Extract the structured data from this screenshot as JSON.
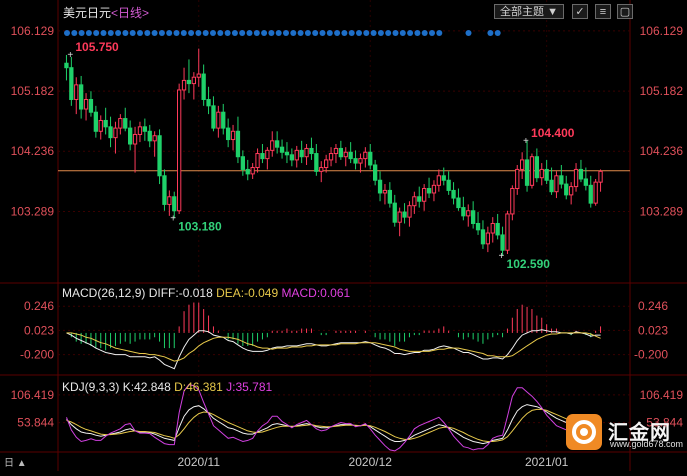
{
  "header": {
    "instrument": "美元日元",
    "period": "<日线>",
    "theme_label": "全部主题",
    "buttons": [
      "✓",
      "≡",
      "▢"
    ]
  },
  "chart_data": [
    {
      "type": "candlestick",
      "name": "price",
      "y_ticks": [
        106.129,
        105.182,
        104.236,
        103.289
      ],
      "ylim": [
        102.4,
        106.3
      ],
      "last_price": 103.93,
      "annotations": [
        {
          "label": "105.750",
          "value": 105.75,
          "index": 1,
          "color": "#ff3a5a"
        },
        {
          "label": "103.180",
          "value": 103.18,
          "index": 22,
          "color": "#33d17a"
        },
        {
          "label": "104.400",
          "value": 104.4,
          "index": 94,
          "color": "#ff3a5a"
        },
        {
          "label": "102.590",
          "value": 102.59,
          "index": 89,
          "color": "#33d17a"
        }
      ],
      "candles": [
        [
          105.62,
          105.75,
          105.35,
          105.55
        ],
        [
          105.55,
          105.72,
          104.95,
          105.05
        ],
        [
          105.05,
          105.4,
          104.82,
          105.28
        ],
        [
          105.28,
          105.42,
          104.75,
          104.9
        ],
        [
          104.9,
          105.15,
          104.72,
          105.05
        ],
        [
          105.05,
          105.18,
          104.78,
          104.85
        ],
        [
          104.85,
          104.95,
          104.45,
          104.55
        ],
        [
          104.55,
          104.8,
          104.42,
          104.72
        ],
        [
          104.72,
          104.92,
          104.5,
          104.62
        ],
        [
          104.62,
          104.78,
          104.3,
          104.45
        ],
        [
          104.45,
          104.7,
          104.2,
          104.6
        ],
        [
          104.6,
          104.82,
          104.5,
          104.75
        ],
        [
          104.75,
          104.92,
          104.55,
          104.6
        ],
        [
          104.6,
          104.72,
          104.25,
          104.35
        ],
        [
          104.35,
          104.62,
          103.9,
          104.5
        ],
        [
          104.5,
          104.7,
          104.38,
          104.62
        ],
        [
          104.62,
          104.75,
          104.4,
          104.55
        ],
        [
          104.55,
          104.65,
          104.3,
          104.4
        ],
        [
          104.4,
          104.55,
          104.15,
          104.48
        ],
        [
          104.48,
          104.58,
          103.72,
          103.85
        ],
        [
          103.85,
          103.95,
          103.3,
          103.4
        ],
        [
          103.4,
          103.62,
          103.22,
          103.52
        ],
        [
          103.52,
          103.6,
          103.18,
          103.3
        ],
        [
          103.3,
          105.3,
          103.25,
          105.2
        ],
        [
          105.2,
          105.55,
          105.05,
          105.35
        ],
        [
          105.35,
          105.68,
          105.15,
          105.3
        ],
        [
          105.3,
          105.48,
          105.05,
          105.4
        ],
        [
          105.4,
          105.85,
          105.25,
          105.45
        ],
        [
          105.45,
          105.6,
          104.95,
          105.05
        ],
        [
          105.05,
          105.25,
          104.82,
          104.95
        ],
        [
          104.95,
          105.1,
          104.55,
          104.6
        ],
        [
          104.6,
          104.95,
          104.45,
          104.85
        ],
        [
          104.85,
          104.98,
          104.5,
          104.6
        ],
        [
          104.6,
          104.75,
          104.3,
          104.42
        ],
        [
          104.42,
          104.65,
          104.25,
          104.55
        ],
        [
          104.55,
          104.78,
          104.05,
          104.15
        ],
        [
          104.15,
          104.25,
          103.85,
          103.95
        ],
        [
          103.95,
          104.1,
          103.78,
          103.88
        ],
        [
          103.88,
          104.05,
          103.8,
          103.98
        ],
        [
          103.98,
          104.28,
          103.9,
          104.2
        ],
        [
          104.2,
          104.35,
          104.05,
          104.12
        ],
        [
          104.12,
          104.3,
          103.95,
          104.25
        ],
        [
          104.25,
          104.55,
          104.15,
          104.4
        ],
        [
          104.4,
          104.55,
          104.2,
          104.3
        ],
        [
          104.3,
          104.42,
          104.12,
          104.22
        ],
        [
          104.22,
          104.38,
          104.05,
          104.18
        ],
        [
          104.18,
          104.28,
          104.0,
          104.1
        ],
        [
          104.1,
          104.32,
          103.98,
          104.25
        ],
        [
          104.25,
          104.4,
          104.05,
          104.15
        ],
        [
          104.15,
          104.35,
          104.02,
          104.28
        ],
        [
          104.28,
          104.45,
          104.1,
          104.2
        ],
        [
          104.2,
          104.35,
          103.85,
          103.92
        ],
        [
          103.92,
          104.08,
          103.75,
          103.98
        ],
        [
          103.98,
          104.18,
          103.9,
          104.1
        ],
        [
          104.1,
          104.3,
          104.0,
          104.2
        ],
        [
          104.2,
          104.35,
          104.05,
          104.28
        ],
        [
          104.28,
          104.4,
          104.1,
          104.15
        ],
        [
          104.15,
          104.3,
          104.0,
          104.22
        ],
        [
          104.22,
          104.38,
          104.05,
          104.12
        ],
        [
          104.12,
          104.25,
          103.95,
          104.05
        ],
        [
          104.05,
          104.2,
          103.9,
          104.12
        ],
        [
          104.12,
          104.3,
          103.98,
          104.22
        ],
        [
          104.22,
          104.35,
          103.95,
          104.02
        ],
        [
          104.02,
          104.1,
          103.7,
          103.78
        ],
        [
          103.78,
          103.92,
          103.45,
          103.58
        ],
        [
          103.58,
          103.72,
          103.4,
          103.62
        ],
        [
          103.62,
          103.75,
          103.35,
          103.42
        ],
        [
          103.42,
          103.55,
          103.05,
          103.12
        ],
        [
          103.12,
          103.35,
          102.9,
          103.28
        ],
        [
          103.28,
          103.42,
          103.1,
          103.2
        ],
        [
          103.2,
          103.45,
          103.05,
          103.38
        ],
        [
          103.38,
          103.6,
          103.25,
          103.52
        ],
        [
          103.52,
          103.68,
          103.35,
          103.45
        ],
        [
          103.45,
          103.72,
          103.3,
          103.65
        ],
        [
          103.65,
          103.82,
          103.5,
          103.58
        ],
        [
          103.58,
          103.78,
          103.45,
          103.7
        ],
        [
          103.7,
          103.95,
          103.6,
          103.85
        ],
        [
          103.85,
          103.98,
          103.7,
          103.78
        ],
        [
          103.78,
          103.92,
          103.55,
          103.62
        ],
        [
          103.62,
          103.75,
          103.4,
          103.5
        ],
        [
          103.5,
          103.65,
          103.3,
          103.35
        ],
        [
          103.35,
          103.52,
          103.15,
          103.22
        ],
        [
          103.22,
          103.4,
          103.05,
          103.3
        ],
        [
          103.3,
          103.45,
          103.02,
          103.1
        ],
        [
          103.1,
          103.28,
          102.92,
          103.0
        ],
        [
          103.0,
          103.15,
          102.7,
          102.78
        ],
        [
          102.78,
          103.05,
          102.65,
          102.95
        ],
        [
          102.95,
          103.2,
          102.8,
          103.1
        ],
        [
          103.1,
          103.25,
          102.85,
          102.92
        ],
        [
          102.92,
          103.05,
          102.59,
          102.68
        ],
        [
          102.68,
          103.3,
          102.62,
          103.25
        ],
        [
          103.25,
          103.7,
          103.15,
          103.65
        ],
        [
          103.65,
          104.02,
          103.55,
          103.95
        ],
        [
          103.95,
          104.22,
          103.8,
          104.1
        ],
        [
          104.1,
          104.4,
          103.6,
          103.7
        ],
        [
          103.7,
          104.2,
          103.65,
          104.15
        ],
        [
          104.15,
          104.28,
          103.75,
          103.82
        ],
        [
          103.82,
          104.05,
          103.7,
          103.95
        ],
        [
          103.95,
          104.1,
          103.72,
          103.78
        ],
        [
          103.78,
          103.98,
          103.55,
          103.6
        ],
        [
          103.6,
          103.92,
          103.5,
          103.85
        ],
        [
          103.85,
          104.02,
          103.65,
          103.72
        ],
        [
          103.72,
          103.85,
          103.48,
          103.55
        ],
        [
          103.55,
          103.75,
          103.4,
          103.68
        ],
        [
          103.68,
          104.05,
          103.6,
          103.95
        ],
        [
          103.95,
          104.1,
          103.75,
          103.8
        ],
        [
          103.8,
          103.98,
          103.62,
          103.7
        ],
        [
          103.7,
          103.85,
          103.35,
          103.42
        ],
        [
          103.42,
          103.8,
          103.38,
          103.75
        ],
        [
          103.75,
          103.95,
          103.6,
          103.92
        ]
      ],
      "dots": {
        "count": 60,
        "color": "#1e6fc8"
      }
    },
    {
      "type": "macd",
      "name": "MACD",
      "label": "MACD(26,12,9)",
      "diff_label": "DIFF:-0.018",
      "dea_label": "DEA:-0.049",
      "macd_label": "MACD:0.061",
      "y_ticks": [
        0.246,
        0.023,
        -0.2
      ],
      "ylim": [
        -0.36,
        0.34
      ],
      "diff": [
        0.0,
        -0.02,
        -0.05,
        -0.07,
        -0.09,
        -0.11,
        -0.14,
        -0.16,
        -0.18,
        -0.19,
        -0.2,
        -0.2,
        -0.2,
        -0.22,
        -0.22,
        -0.22,
        -0.22,
        -0.23,
        -0.22,
        -0.25,
        -0.29,
        -0.31,
        -0.33,
        -0.22,
        -0.13,
        -0.06,
        -0.02,
        0.02,
        0.02,
        0.01,
        -0.02,
        -0.03,
        -0.04,
        -0.07,
        -0.08,
        -0.11,
        -0.14,
        -0.16,
        -0.17,
        -0.17,
        -0.17,
        -0.16,
        -0.14,
        -0.13,
        -0.13,
        -0.12,
        -0.12,
        -0.12,
        -0.11,
        -0.1,
        -0.1,
        -0.11,
        -0.12,
        -0.12,
        -0.11,
        -0.1,
        -0.09,
        -0.09,
        -0.09,
        -0.09,
        -0.09,
        -0.08,
        -0.09,
        -0.11,
        -0.13,
        -0.14,
        -0.16,
        -0.19,
        -0.19,
        -0.2,
        -0.19,
        -0.18,
        -0.18,
        -0.16,
        -0.16,
        -0.15,
        -0.13,
        -0.12,
        -0.13,
        -0.14,
        -0.16,
        -0.18,
        -0.18,
        -0.2,
        -0.22,
        -0.24,
        -0.24,
        -0.23,
        -0.23,
        -0.24,
        -0.2,
        -0.14,
        -0.07,
        -0.02,
        0.0,
        0.02,
        0.02,
        0.03,
        0.02,
        0.01,
        0.01,
        0.0,
        0.0,
        -0.01,
        0.01,
        0.0,
        -0.01,
        -0.03,
        -0.02,
        -0.02
      ],
      "dea": [
        0.0,
        0.0,
        -0.01,
        -0.02,
        -0.04,
        -0.05,
        -0.07,
        -0.09,
        -0.1,
        -0.12,
        -0.14,
        -0.15,
        -0.16,
        -0.17,
        -0.18,
        -0.19,
        -0.19,
        -0.2,
        -0.2,
        -0.21,
        -0.22,
        -0.24,
        -0.26,
        -0.25,
        -0.23,
        -0.19,
        -0.16,
        -0.12,
        -0.09,
        -0.07,
        -0.05,
        -0.04,
        -0.04,
        -0.04,
        -0.05,
        -0.06,
        -0.08,
        -0.1,
        -0.11,
        -0.13,
        -0.14,
        -0.14,
        -0.15,
        -0.14,
        -0.14,
        -0.14,
        -0.13,
        -0.13,
        -0.13,
        -0.12,
        -0.12,
        -0.11,
        -0.11,
        -0.11,
        -0.11,
        -0.11,
        -0.1,
        -0.1,
        -0.1,
        -0.1,
        -0.09,
        -0.09,
        -0.09,
        -0.09,
        -0.1,
        -0.11,
        -0.12,
        -0.13,
        -0.15,
        -0.16,
        -0.17,
        -0.17,
        -0.17,
        -0.17,
        -0.17,
        -0.16,
        -0.15,
        -0.15,
        -0.14,
        -0.14,
        -0.14,
        -0.15,
        -0.16,
        -0.17,
        -0.18,
        -0.19,
        -0.21,
        -0.21,
        -0.22,
        -0.22,
        -0.22,
        -0.21,
        -0.18,
        -0.15,
        -0.12,
        -0.09,
        -0.06,
        -0.04,
        -0.02,
        -0.01,
        -0.01,
        0.0,
        0.0,
        0.0,
        0.0,
        0.0,
        0.0,
        -0.01,
        -0.03,
        -0.05
      ]
    },
    {
      "type": "kdj",
      "name": "KDJ",
      "label": "KDJ(9,3,3)",
      "k_label": "K:42.848",
      "d_label": "D:46.381",
      "j_label": "J:35.781",
      "y_ticks": [
        106.419,
        53.844
      ],
      "ylim": [
        -2,
        112
      ],
      "k": [
        60,
        50,
        42,
        36,
        34,
        33,
        30,
        28,
        30,
        32,
        34,
        36,
        40,
        42,
        38,
        36,
        36,
        35,
        32,
        28,
        24,
        22,
        20,
        45,
        66,
        78,
        84,
        86,
        80,
        72,
        62,
        56,
        50,
        44,
        42,
        38,
        34,
        32,
        32,
        36,
        40,
        44,
        50,
        52,
        50,
        48,
        46,
        48,
        50,
        52,
        50,
        46,
        44,
        44,
        46,
        48,
        50,
        50,
        50,
        48,
        48,
        50,
        46,
        40,
        34,
        28,
        22,
        18,
        18,
        20,
        24,
        30,
        34,
        38,
        42,
        46,
        50,
        48,
        44,
        38,
        32,
        26,
        22,
        18,
        16,
        14,
        16,
        20,
        22,
        24,
        40,
        60,
        76,
        84,
        88,
        86,
        84,
        80,
        74,
        68,
        62,
        58,
        54,
        52,
        50,
        48,
        46,
        44,
        43,
        42.8
      ],
      "d": [
        58,
        55,
        50,
        45,
        41,
        38,
        35,
        32,
        31,
        31,
        32,
        33,
        35,
        37,
        38,
        37,
        37,
        36,
        35,
        32,
        29,
        27,
        24,
        31,
        42,
        54,
        64,
        71,
        74,
        73,
        69,
        64,
        59,
        54,
        50,
        46,
        42,
        38,
        36,
        35,
        36,
        39,
        42,
        45,
        47,
        47,
        47,
        47,
        48,
        49,
        50,
        48,
        47,
        46,
        46,
        47,
        48,
        49,
        49,
        49,
        48,
        49,
        48,
        45,
        41,
        37,
        32,
        27,
        24,
        22,
        22,
        24,
        27,
        31,
        35,
        39,
        43,
        45,
        45,
        43,
        39,
        35,
        30,
        26,
        22,
        19,
        18,
        18,
        19,
        21,
        27,
        38,
        50,
        62,
        71,
        77,
        79,
        79,
        77,
        73,
        69,
        65,
        61,
        58,
        55,
        52,
        50,
        48,
        47,
        46.4
      ],
      "j": [
        64,
        40,
        26,
        18,
        20,
        23,
        20,
        20,
        28,
        34,
        38,
        42,
        50,
        52,
        38,
        34,
        34,
        33,
        26,
        20,
        14,
        12,
        12,
        73,
        114,
        126,
        124,
        116,
        92,
        70,
        48,
        40,
        32,
        24,
        26,
        22,
        18,
        20,
        24,
        38,
        48,
        54,
        66,
        66,
        56,
        50,
        44,
        50,
        54,
        58,
        50,
        42,
        38,
        40,
        46,
        50,
        54,
        52,
        52,
        46,
        48,
        52,
        42,
        30,
        20,
        10,
        2,
        0,
        6,
        16,
        28,
        42,
        48,
        52,
        56,
        60,
        64,
        54,
        42,
        28,
        18,
        8,
        6,
        2,
        4,
        4,
        12,
        24,
        28,
        30,
        66,
        104,
        120,
        120,
        112,
        104,
        94,
        82,
        68,
        58,
        48,
        44,
        40,
        40,
        40,
        40,
        38,
        36,
        35,
        35.8
      ]
    }
  ],
  "x_axis": {
    "labels": [
      "2020/11",
      "2020/12",
      "2021/01"
    ],
    "label_index": [
      27,
      62,
      98
    ]
  },
  "logo": {
    "name": "汇金网",
    "url": "www.gold678.com"
  },
  "corner_text": "日 ▲"
}
